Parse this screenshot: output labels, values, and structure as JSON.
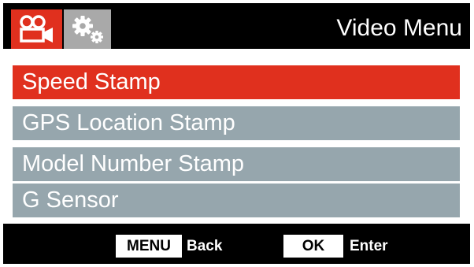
{
  "header": {
    "title": "Video Menu",
    "tabs": [
      {
        "icon": "video-camera-icon",
        "active": true
      },
      {
        "icon": "gears-icon",
        "active": false
      }
    ]
  },
  "menu": {
    "items": [
      {
        "label": "Speed Stamp",
        "selected": true
      },
      {
        "label": "GPS Location Stamp",
        "selected": false
      },
      {
        "label": "Model Number Stamp",
        "selected": false
      },
      {
        "label": "G Sensor",
        "selected": false
      }
    ]
  },
  "footer": {
    "menu_key": "MENU",
    "menu_action": "Back",
    "ok_key": "OK",
    "ok_action": "Enter"
  },
  "colors": {
    "accent": "#e0301e",
    "item_background": "#96a6ad",
    "inactive_tab": "#a9a9a9",
    "screen_background": "#000000"
  }
}
